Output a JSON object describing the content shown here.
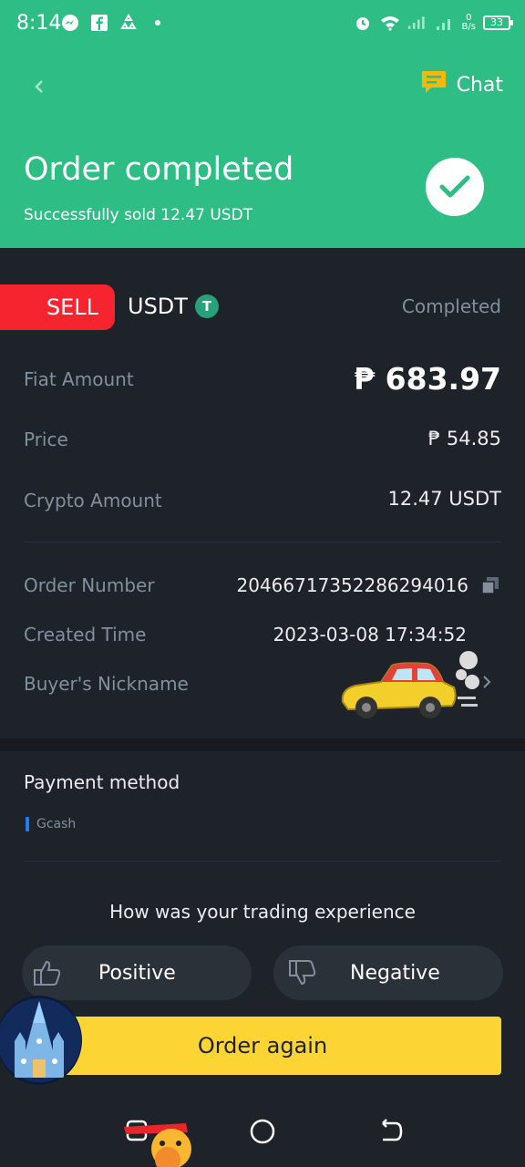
{
  "status_bar": {
    "time": "8:14",
    "net_speed_value": "0",
    "net_speed_unit": "B/s",
    "battery": "33"
  },
  "header": {
    "chat_label": "Chat",
    "title": "Order completed",
    "subtitle": "Successfully sold  12.47 USDT"
  },
  "order": {
    "side": "SELL",
    "asset": "USDT",
    "asset_icon_glyph": "T",
    "status": "Completed",
    "rows": [
      {
        "label": "Fiat Amount",
        "value": "₱ 683.97"
      },
      {
        "label": "Price",
        "value": "₱ 54.85"
      },
      {
        "label": "Crypto Amount",
        "value": "12.47 USDT"
      },
      {
        "label": "Order Number",
        "value": "20466717352286294016"
      },
      {
        "label": "Created Time",
        "value": "2023-03-08 17:34:52"
      },
      {
        "label": "Buyer's Nickname",
        "value": ""
      }
    ]
  },
  "payment": {
    "title": "Payment method",
    "method": "Gcash"
  },
  "feedback": {
    "question": "How was your trading experience",
    "positive": "Positive",
    "negative": "Negative"
  },
  "actions": {
    "order_again": "Order again"
  },
  "colors": {
    "header_green": "#2ebd85",
    "sell_red": "#f6242f",
    "button_yellow": "#fcd535",
    "bg_dark": "#1e2329",
    "gcash_blue": "#1e7bf0"
  },
  "icons": {
    "back": "back-arrow-icon",
    "chat": "chat-bubble-icon",
    "check": "checkmark-icon",
    "copy": "copy-icon",
    "chevron": "chevron-right-icon",
    "thumb_up": "thumbs-up-icon",
    "thumb_down": "thumbs-down-icon"
  }
}
